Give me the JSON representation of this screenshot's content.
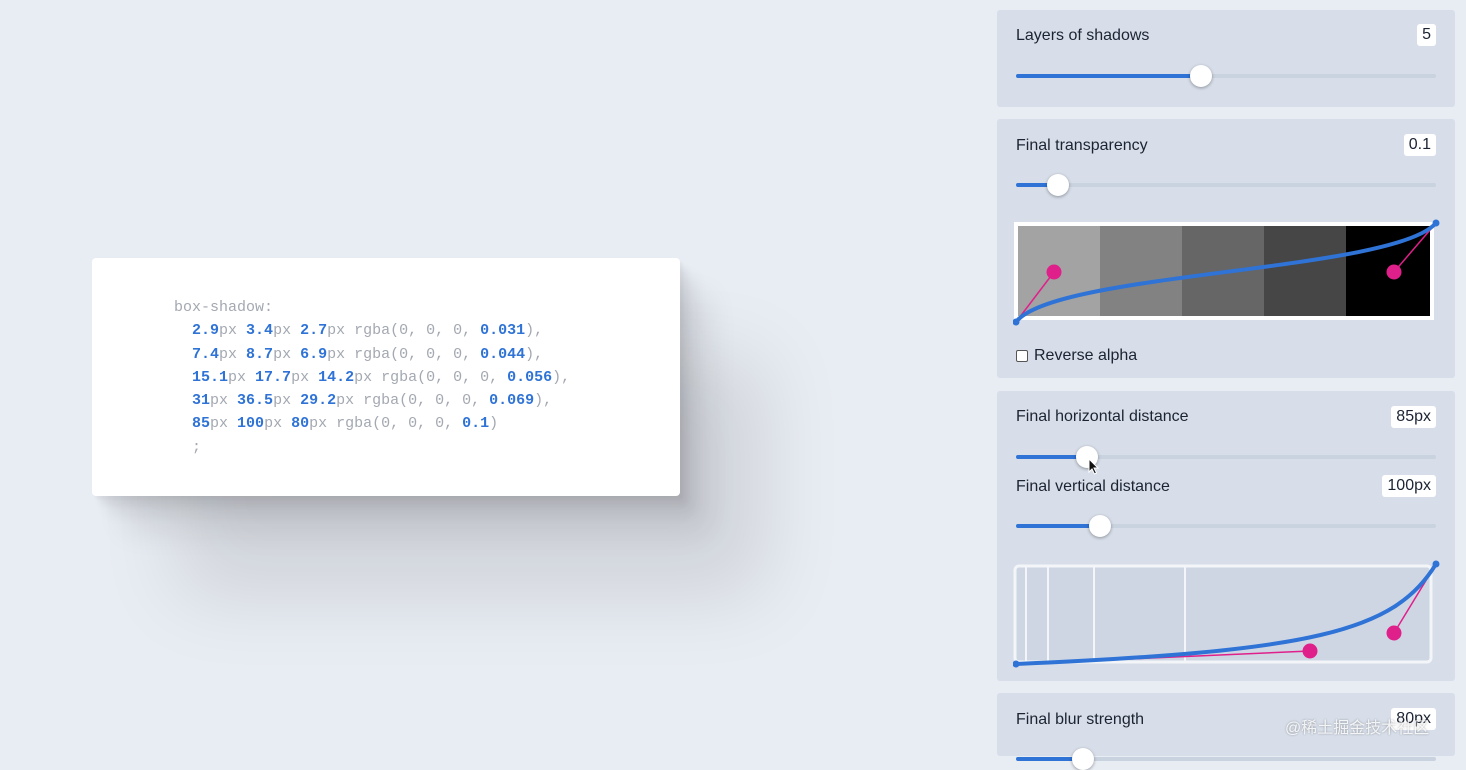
{
  "code": {
    "prop": "box-shadow:",
    "close": ";",
    "layers": [
      {
        "h": "2.9",
        "v": "3.4",
        "b": "2.7",
        "a": "0.031",
        "end": "),"
      },
      {
        "h": "7.4",
        "v": "8.7",
        "b": "6.9",
        "a": "0.044",
        "end": "),"
      },
      {
        "h": "15.1",
        "v": "17.7",
        "b": "14.2",
        "a": "0.056",
        "end": "),"
      },
      {
        "h": "31",
        "v": "36.5",
        "b": "29.2",
        "a": "0.069",
        "end": "),"
      },
      {
        "h": "85",
        "v": "100",
        "b": "80",
        "a": "0.1",
        "end": ")"
      }
    ],
    "unit": "px",
    "rgba_prefix": "rgba(0, 0, 0, "
  },
  "controls": {
    "layers": {
      "label": "Layers of shadows",
      "value": "5",
      "level": 0.44
    },
    "transparency": {
      "label": "Final transparency",
      "value": "0.1",
      "level": 0.1
    },
    "reverse_alpha": {
      "label": "Reverse alpha",
      "checked": false
    },
    "horizontal": {
      "label": "Final horizontal distance",
      "value": "85px",
      "level": 0.17
    },
    "vertical": {
      "label": "Final vertical distance",
      "value": "100px",
      "level": 0.2
    },
    "blur": {
      "label": "Final blur strength",
      "value": "80px",
      "level": 0.16
    }
  },
  "alpha_swatches": [
    "#a3a3a3",
    "#828282",
    "#666666",
    "#464646",
    "#000000"
  ],
  "colors": {
    "accent": "#2f73d6",
    "handle": "#e0208a",
    "panel": "#d7dee9",
    "background": "#e8ecf3"
  },
  "watermark": "@稀土掘金技术社区"
}
